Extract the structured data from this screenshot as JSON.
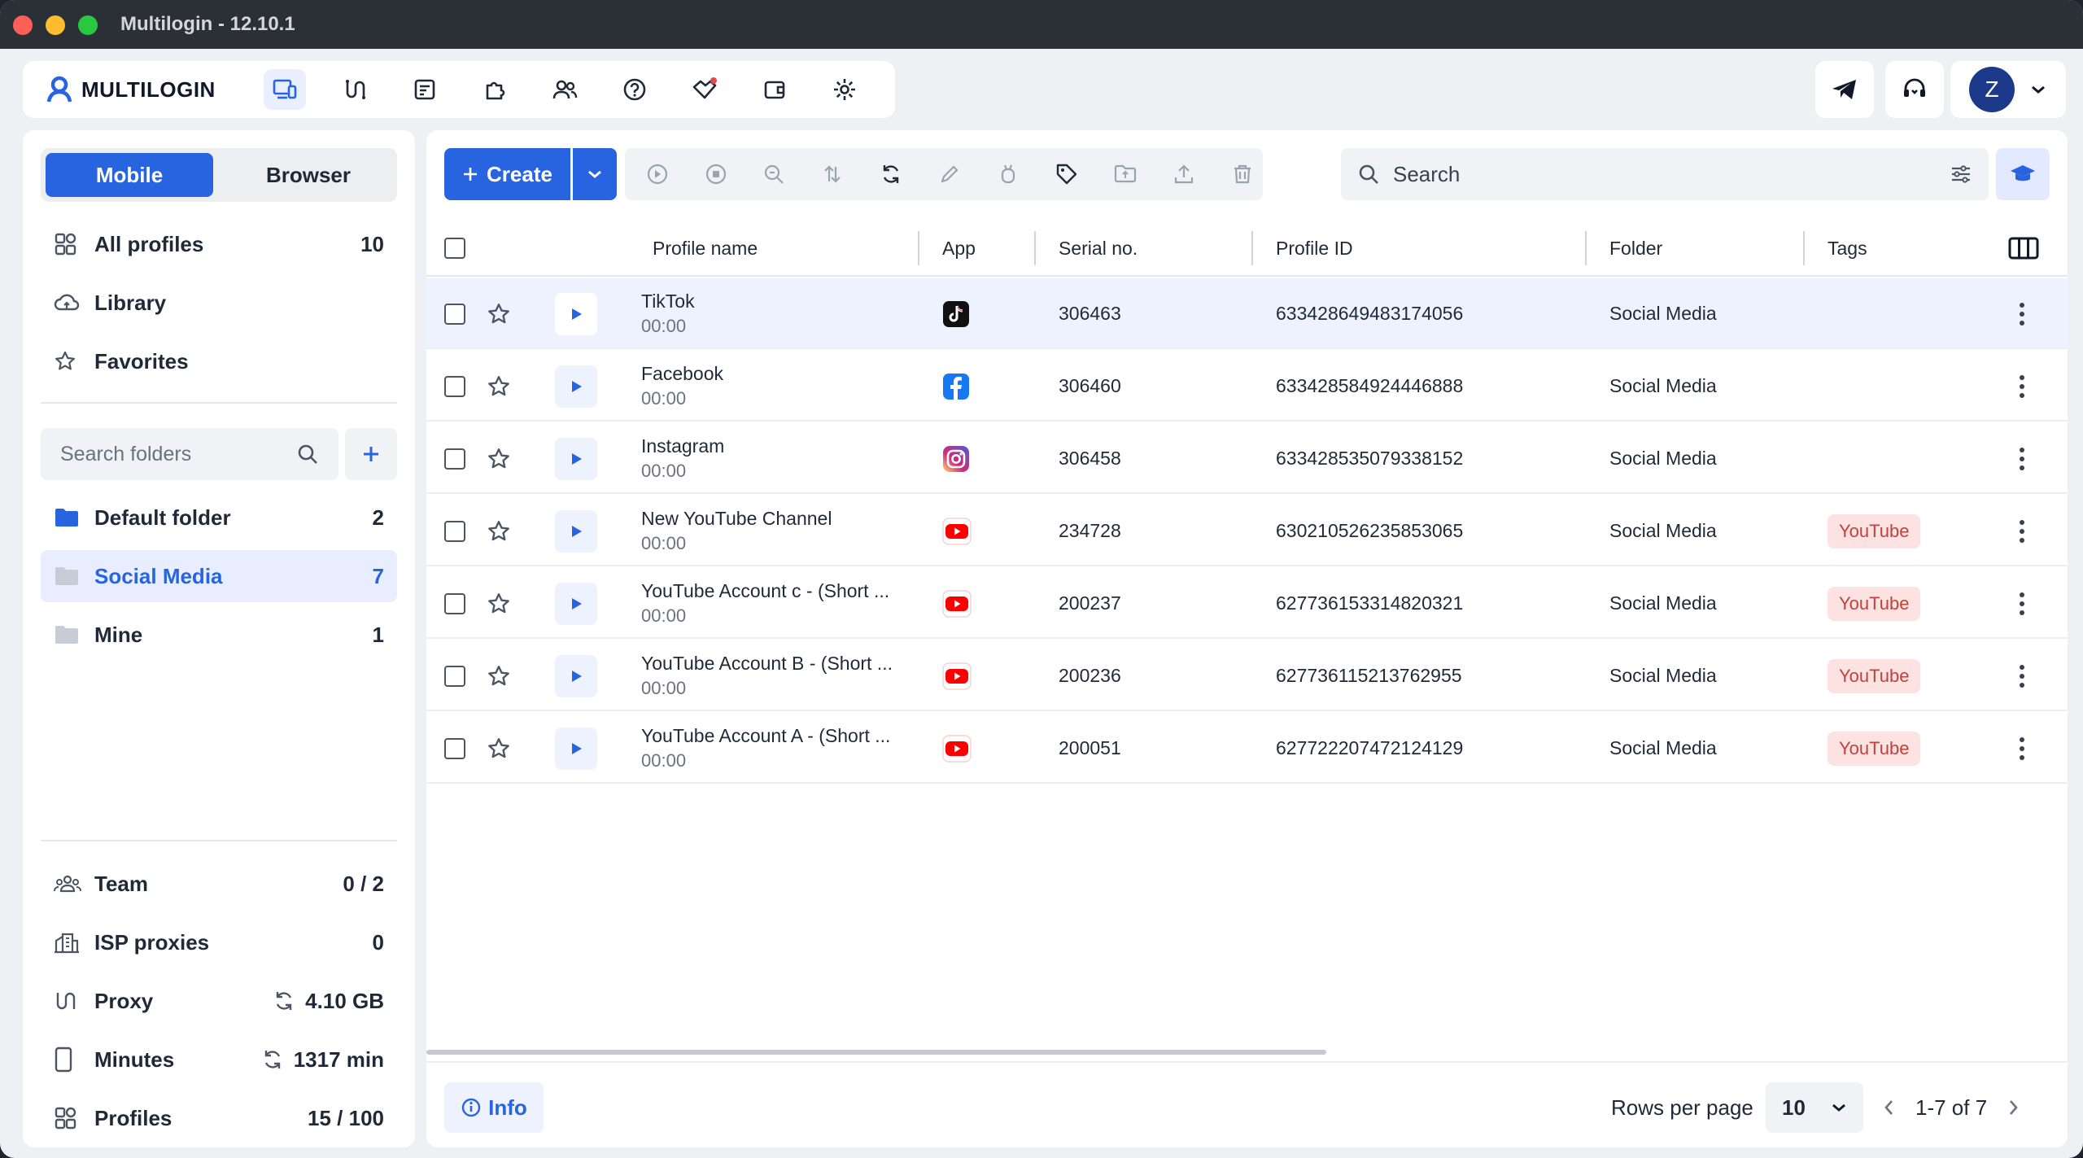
{
  "window": {
    "title": "Multilogin - 12.10.1"
  },
  "brand": {
    "name": "MULTILOGIN",
    "accent": "#2864e0"
  },
  "topnav": {
    "icons": [
      "profiles-icon",
      "proxy-icon",
      "automation-icon",
      "extensions-icon",
      "team-icon",
      "help-icon",
      "referral-icon",
      "wallet-icon",
      "settings-icon"
    ]
  },
  "user": {
    "initial": "Z"
  },
  "sidebar": {
    "tabs": {
      "mobile": "Mobile",
      "browser": "Browser",
      "selected": "Mobile"
    },
    "nav": [
      {
        "label": "All profiles",
        "count": "10"
      },
      {
        "label": "Library",
        "count": ""
      },
      {
        "label": "Favorites",
        "count": ""
      }
    ],
    "folder_search_placeholder": "Search folders",
    "folders": [
      {
        "label": "Default folder",
        "count": "2",
        "selected": false
      },
      {
        "label": "Social Media",
        "count": "7",
        "selected": true
      },
      {
        "label": "Mine",
        "count": "1",
        "selected": false
      }
    ],
    "stats": [
      {
        "label": "Team",
        "value": "0 / 2"
      },
      {
        "label": "ISP proxies",
        "value": "0"
      },
      {
        "label": "Proxy",
        "value": "4.10 GB"
      },
      {
        "label": "Minutes",
        "value": "1317 min"
      },
      {
        "label": "Profiles",
        "value": "15 / 100"
      }
    ]
  },
  "toolbar": {
    "create_label": "Create",
    "search_placeholder": "Search"
  },
  "table": {
    "columns": {
      "name": "Profile name",
      "app": "App",
      "serial": "Serial no.",
      "id": "Profile ID",
      "folder": "Folder",
      "tags": "Tags"
    },
    "rows": [
      {
        "name": "TikTok",
        "time": "00:00",
        "app": "tiktok",
        "serial": "306463",
        "id": "633428649483174056",
        "folder": "Social Media",
        "tag": ""
      },
      {
        "name": "Facebook",
        "time": "00:00",
        "app": "facebook",
        "serial": "306460",
        "id": "633428584924446888",
        "folder": "Social Media",
        "tag": ""
      },
      {
        "name": "Instagram",
        "time": "00:00",
        "app": "instagram",
        "serial": "306458",
        "id": "633428535079338152",
        "folder": "Social Media",
        "tag": ""
      },
      {
        "name": "New YouTube Channel",
        "time": "00:00",
        "app": "youtube",
        "serial": "234728",
        "id": "630210526235853065",
        "folder": "Social Media",
        "tag": "YouTube"
      },
      {
        "name": "YouTube Account c - (Short ...",
        "time": "00:00",
        "app": "youtube",
        "serial": "200237",
        "id": "627736153314820321",
        "folder": "Social Media",
        "tag": "YouTube"
      },
      {
        "name": "YouTube Account B - (Short ...",
        "time": "00:00",
        "app": "youtube",
        "serial": "200236",
        "id": "627736115213762955",
        "folder": "Social Media",
        "tag": "YouTube"
      },
      {
        "name": "YouTube Account A - (Short ...",
        "time": "00:00",
        "app": "youtube",
        "serial": "200051",
        "id": "627722207472124129",
        "folder": "Social Media",
        "tag": "YouTube"
      }
    ]
  },
  "footer": {
    "info_label": "Info",
    "rows_per_page_label": "Rows per page",
    "rows_per_page_value": "10",
    "range": "1-7 of 7"
  }
}
